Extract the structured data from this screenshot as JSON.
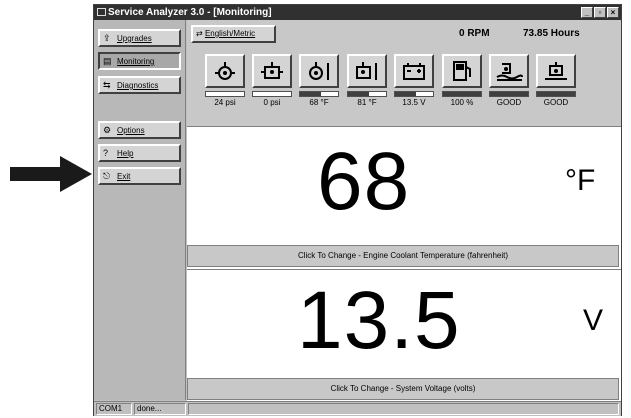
{
  "window": {
    "title": "Service Analyzer 3.0 - [Monitoring]",
    "controls": {
      "minimize": "_",
      "restore": "▫",
      "close": "×"
    }
  },
  "sidebar": {
    "items": [
      {
        "label": "Upgrades",
        "icon": "upgrades-icon",
        "glyph": "⇪"
      },
      {
        "label": "Monitoring",
        "icon": "monitoring-icon",
        "glyph": "▤",
        "active": true
      },
      {
        "label": "Diagnostics",
        "icon": "diagnostics-icon",
        "glyph": "⇆"
      },
      {
        "label": "Options",
        "icon": "options-icon",
        "glyph": "⚙"
      },
      {
        "label": "Help",
        "icon": "help-icon",
        "glyph": "?"
      },
      {
        "label": "Exit",
        "icon": "exit-icon",
        "glyph": "⎋"
      }
    ]
  },
  "topbar": {
    "units_button": "English/Metric",
    "rpm": "0 RPM",
    "hours": "73.85 Hours"
  },
  "gauges": [
    {
      "name": "oil-pressure",
      "icon": "oil-can-icon",
      "value": "24 psi",
      "level": 0
    },
    {
      "name": "fuel-pressure",
      "icon": "engine-pressure-icon",
      "value": "0 psi",
      "level": 0
    },
    {
      "name": "oil-temperature",
      "icon": "oil-temp-icon",
      "value": "68 °F",
      "level": 0.55
    },
    {
      "name": "coolant-temperature",
      "icon": "coolant-temp-icon",
      "value": "81 °F",
      "level": 0.55
    },
    {
      "name": "system-voltage",
      "icon": "battery-icon",
      "value": "13.5 V",
      "level": 0.55
    },
    {
      "name": "fuel-level",
      "icon": "fuel-pump-icon",
      "value": "100 %",
      "level": 1
    },
    {
      "name": "coolant-level",
      "icon": "coolant-level-icon",
      "value": "GOOD",
      "level": 1
    },
    {
      "name": "oil-level",
      "icon": "oil-level-icon",
      "value": "GOOD",
      "level": 1
    }
  ],
  "panels": [
    {
      "value": "68",
      "unit": "°F",
      "caption": "Click To Change - Engine Coolant Temperature (fahrenheit)"
    },
    {
      "value": "13.5",
      "unit": "V",
      "caption": "Click To Change - System Voltage (volts)"
    }
  ],
  "statusbar": {
    "port": "COM1",
    "state": "done..."
  },
  "colors": {
    "face": "#c0c0c0",
    "dark": "#404040",
    "titlebar": "#303030",
    "panel": "#ffffff"
  }
}
